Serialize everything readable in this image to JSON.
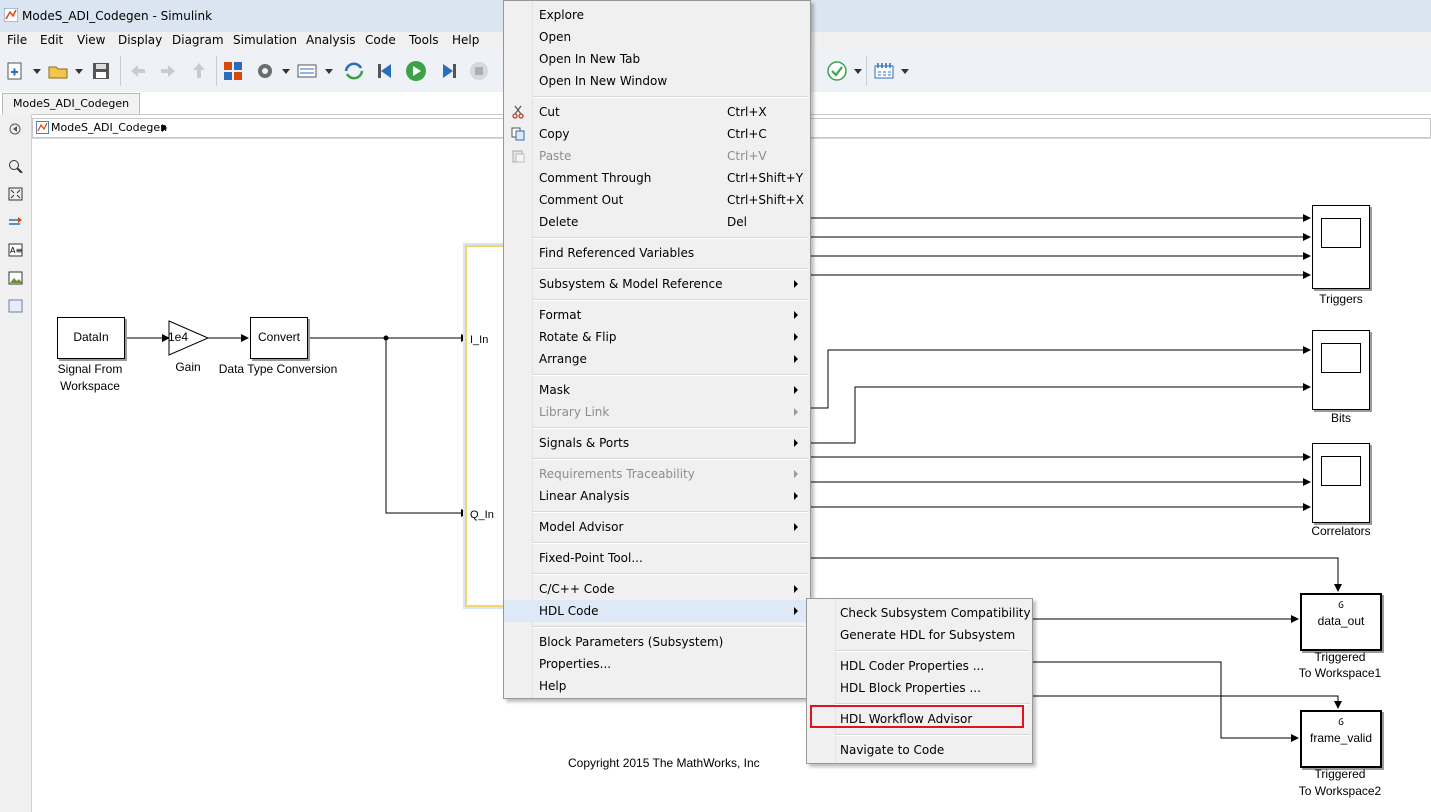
{
  "window": {
    "title": "ModeS_ADI_Codegen - Simulink"
  },
  "menubar": {
    "items": [
      "File",
      "Edit",
      "View",
      "Display",
      "Diagram",
      "Simulation",
      "Analysis",
      "Code",
      "Tools",
      "Help"
    ]
  },
  "tab": {
    "label": "ModeS_ADI_Codegen"
  },
  "breadcrumb": {
    "label": "ModeS_ADI_Codegen"
  },
  "blocks": {
    "signal_from_workspace": {
      "text": "DataIn",
      "label1": "Signal From",
      "label2": "Workspace"
    },
    "gain": {
      "text": "1e4",
      "label": "Gain"
    },
    "convert": {
      "text": "Convert",
      "label": "Data Type Conversion"
    },
    "subsystem": {
      "port1": "I_In",
      "port2": "Q_In"
    },
    "triggers_scope": {
      "label": "Triggers"
    },
    "bits_scope": {
      "label": "Bits"
    },
    "correlators_scope": {
      "label": "Correlators"
    },
    "data_out": {
      "text": "data_out",
      "label1": "Triggered",
      "label2": "To Workspace1"
    },
    "frame_valid": {
      "text": "frame_valid",
      "label1": "Triggered",
      "label2": "To Workspace2"
    }
  },
  "copyright": "Copyright 2015 The MathWorks, Inc",
  "context_menu": {
    "items": [
      {
        "label": "Explore"
      },
      {
        "label": "Open"
      },
      {
        "label": "Open In New Tab"
      },
      {
        "label": "Open In New Window"
      },
      {
        "label": "Cut",
        "shortcut": "Ctrl+X"
      },
      {
        "label": "Copy",
        "shortcut": "Ctrl+C"
      },
      {
        "label": "Paste",
        "shortcut": "Ctrl+V",
        "disabled": true
      },
      {
        "label": "Comment Through",
        "shortcut": "Ctrl+Shift+Y"
      },
      {
        "label": "Comment Out",
        "shortcut": "Ctrl+Shift+X"
      },
      {
        "label": "Delete",
        "shortcut": "Del"
      },
      {
        "label": "Find Referenced Variables"
      },
      {
        "label": "Subsystem & Model Reference",
        "submenu": true
      },
      {
        "label": "Format",
        "submenu": true
      },
      {
        "label": "Rotate & Flip",
        "submenu": true
      },
      {
        "label": "Arrange",
        "submenu": true
      },
      {
        "label": "Mask",
        "submenu": true
      },
      {
        "label": "Library Link",
        "submenu": true,
        "disabled": true
      },
      {
        "label": "Signals & Ports",
        "submenu": true
      },
      {
        "label": "Requirements Traceability",
        "submenu": true,
        "disabled": true
      },
      {
        "label": "Linear Analysis",
        "submenu": true
      },
      {
        "label": "Model Advisor",
        "submenu": true
      },
      {
        "label": "Fixed-Point Tool..."
      },
      {
        "label": "C/C++ Code",
        "submenu": true
      },
      {
        "label": "HDL Code",
        "submenu": true,
        "highlighted": true
      },
      {
        "label": "Block Parameters (Subsystem)"
      },
      {
        "label": "Properties..."
      },
      {
        "label": "Help"
      }
    ]
  },
  "hdl_submenu": {
    "items": [
      {
        "label": "Check Subsystem Compatibility"
      },
      {
        "label": "Generate HDL for Subsystem"
      },
      {
        "label": "HDL Coder Properties ..."
      },
      {
        "label": "HDL Block Properties ..."
      },
      {
        "label": "HDL Workflow Advisor",
        "outlined": true
      },
      {
        "label": "Navigate to Code"
      }
    ]
  },
  "colors": {
    "highlight_outline": "#e0141e",
    "subsystem_border": "#f2d56b",
    "menu_highlight": "#dde9f7"
  }
}
